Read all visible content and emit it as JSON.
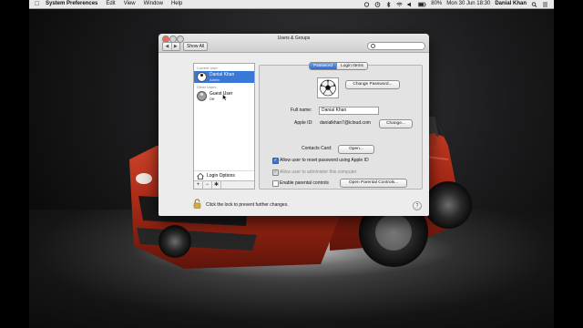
{
  "menubar": {
    "app_name": "System Preferences",
    "menus": [
      "Edit",
      "View",
      "Window",
      "Help"
    ],
    "battery": "80%",
    "clock": "Mon 30 Jun  18:30",
    "user": "Danial Khan"
  },
  "window": {
    "title": "Users & Groups",
    "show_all": "Show All",
    "search_placeholder": ""
  },
  "sidebar": {
    "current_header": "Current User",
    "current_user": {
      "name": "Danial Khan",
      "role": "Admin"
    },
    "other_header": "Other Users",
    "other_user": {
      "name": "Guest User",
      "role": "Off"
    },
    "login_options": "Login Options",
    "add_label": "+",
    "remove_label": "−",
    "action_label": "✱"
  },
  "tabs": {
    "password": "Password",
    "login_items": "Login Items"
  },
  "main": {
    "change_password": "Change Password...",
    "full_name_label": "Full name:",
    "full_name_value": "Danial Khan",
    "apple_id_label": "Apple ID:",
    "apple_id_value": "danialkhan7@icloud.com",
    "apple_id_change": "Change...",
    "contacts_card_label": "Contacts Card:",
    "contacts_open": "Open...",
    "opt_reset": "Allow user to reset password using Apple ID",
    "opt_admin": "Allow user to administer this computer",
    "opt_parental": "Enable parental controls",
    "open_parental": "Open Parental Controls...",
    "checked_reset": true,
    "checked_admin": true,
    "checked_parental": false
  },
  "footer": {
    "lock_text": "Click the lock to prevent further changes.",
    "help": "?"
  },
  "colors": {
    "selection": "#3a78d8",
    "car": "#b8321c"
  }
}
